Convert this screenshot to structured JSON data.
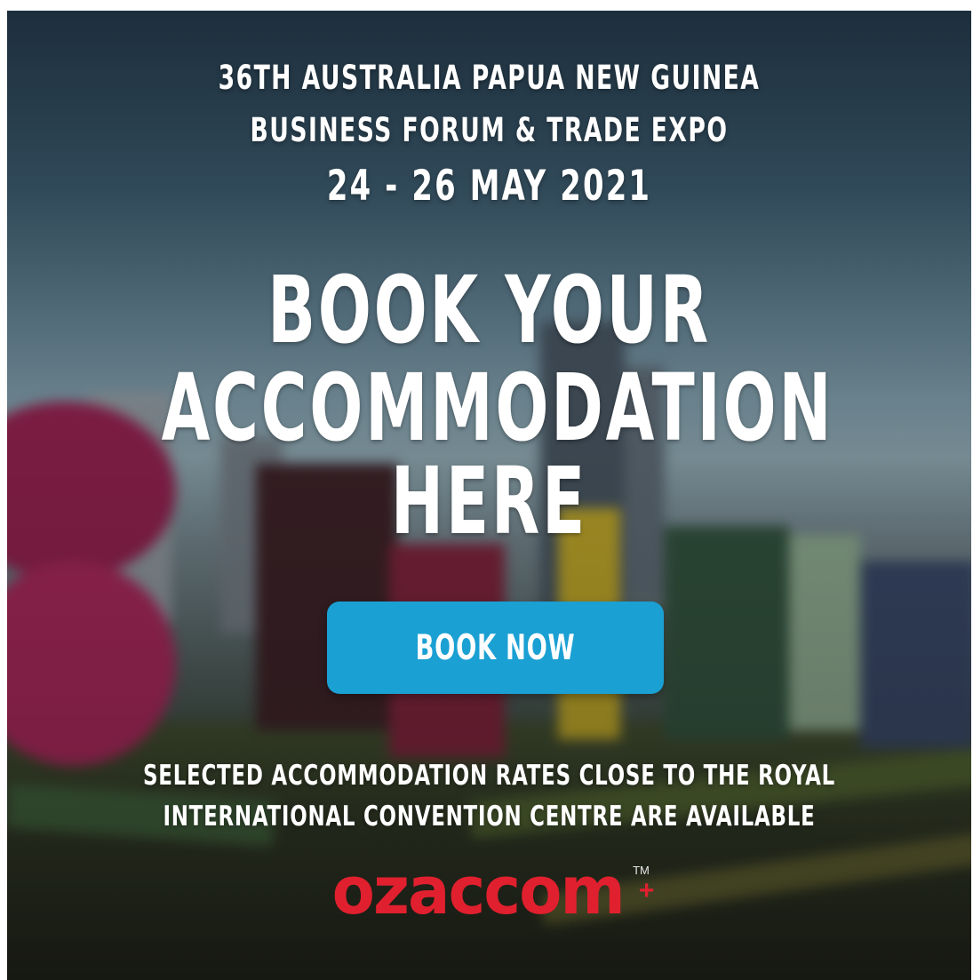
{
  "event": {
    "line1": "36TH AUSTRALIA PAPUA NEW GUINEA",
    "line2": "BUSINESS FORUM & TRADE EXPO",
    "date": "24 - 26 MAY 2021"
  },
  "headline": {
    "line1": "BOOK YOUR",
    "line2": "ACCOMMODATION",
    "line3": "HERE"
  },
  "cta": {
    "label": "BOOK NOW",
    "color": "#1aa0d3"
  },
  "info": {
    "line1": "SELECTED ACCOMMODATION RATES CLOSE TO THE ROYAL",
    "line2": "INTERNATIONAL CONVENTION CENTRE ARE AVAILABLE"
  },
  "brand": {
    "name": "ozaccom",
    "trademark": "TM",
    "plus": "+",
    "color": "#e0202e"
  }
}
